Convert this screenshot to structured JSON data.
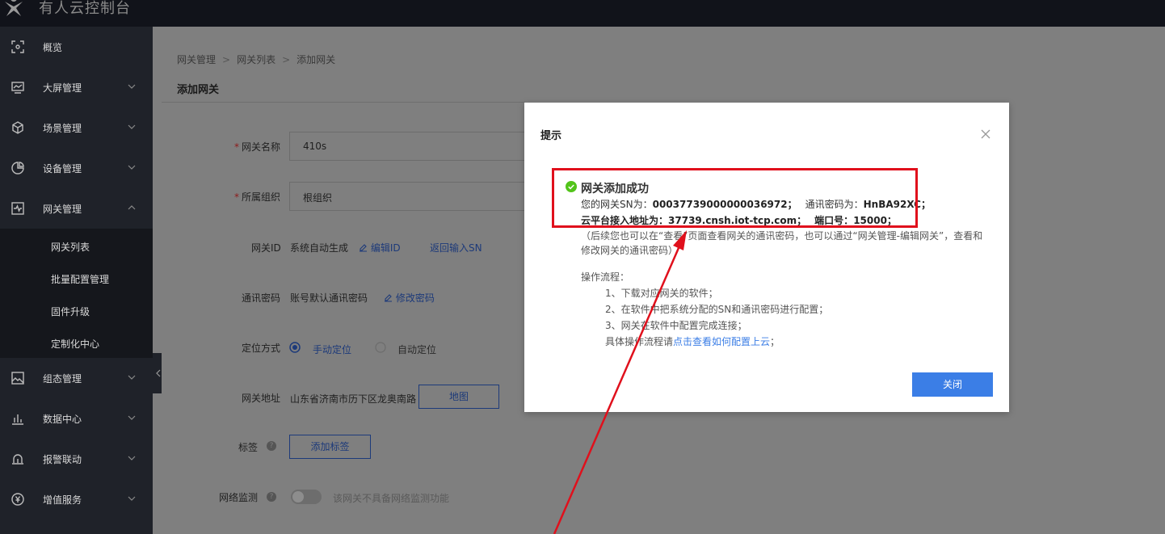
{
  "app": {
    "title": "有人云控制台"
  },
  "sidebar": {
    "items": [
      {
        "label": "概览",
        "icon": "dashboard-icon"
      },
      {
        "label": "大屏管理",
        "icon": "monitor-icon"
      },
      {
        "label": "场景管理",
        "icon": "cube-icon"
      },
      {
        "label": "设备管理",
        "icon": "pie-icon"
      },
      {
        "label": "网关管理",
        "icon": "gateway-icon"
      },
      {
        "label": "组态管理",
        "icon": "image-icon"
      },
      {
        "label": "数据中心",
        "icon": "bar-chart-icon"
      },
      {
        "label": "报警联动",
        "icon": "alarm-icon"
      },
      {
        "label": "增值服务",
        "icon": "yen-icon"
      }
    ],
    "submenu": [
      "网关列表",
      "批量配置管理",
      "固件升级",
      "定制化中心"
    ]
  },
  "breadcrumb": [
    "网关管理",
    "网关列表",
    "添加网关"
  ],
  "page": {
    "title": "添加网关"
  },
  "form": {
    "name_label": "网关名称",
    "name_value": "410s",
    "org_label": "所属组织",
    "org_value": "根组织",
    "id_label": "网关ID",
    "id_value": "系统自动生成",
    "id_edit": "编辑ID",
    "id_return": "返回输入SN",
    "pwd_label": "通讯密码",
    "pwd_value": "账号默认通讯密码",
    "pwd_edit": "修改密码",
    "loc_label": "定位方式",
    "loc_manual": "手动定位",
    "loc_auto": "自动定位",
    "addr_label": "网关地址",
    "addr_value": "山东省济南市历下区龙奥南路",
    "map_button": "地图",
    "tag_label": "标签",
    "tag_button": "添加标签",
    "net_label": "网络监测",
    "net_note": "该网关不具备网络监测功能"
  },
  "modal": {
    "title": "提示",
    "success_title": "网关添加成功",
    "sn_prefix": "您的网关SN为：",
    "sn_value": "00037739000000036972；",
    "pwd_prefix": "通讯密码为：",
    "pwd_value": "HnBA92XC；",
    "addr_prefix": "云平台接入地址为：",
    "addr_value": "37739.cnsh.iot-tcp.com；",
    "port_prefix": "端口号：",
    "port_value": "15000；",
    "note": "（后续您也可以在“查看”页面查看网关的通讯密码，也可以通过“网关管理-编辑网关”，查看和修改网关的通讯密码）",
    "flow_title": "操作流程：",
    "steps": [
      "1、下载对应网关的软件；",
      "2、在软件中把系统分配的SN和通讯密码进行配置；",
      "3、网关在软件中配置完成连接；"
    ],
    "detail_prefix": "具体操作流程请",
    "detail_link": "点击查看如何配置上云",
    "detail_suffix": "；",
    "close_button": "关闭"
  },
  "colors": {
    "accent": "#3b7ee6",
    "annotation": "#e0101c",
    "success": "#52c41a"
  }
}
